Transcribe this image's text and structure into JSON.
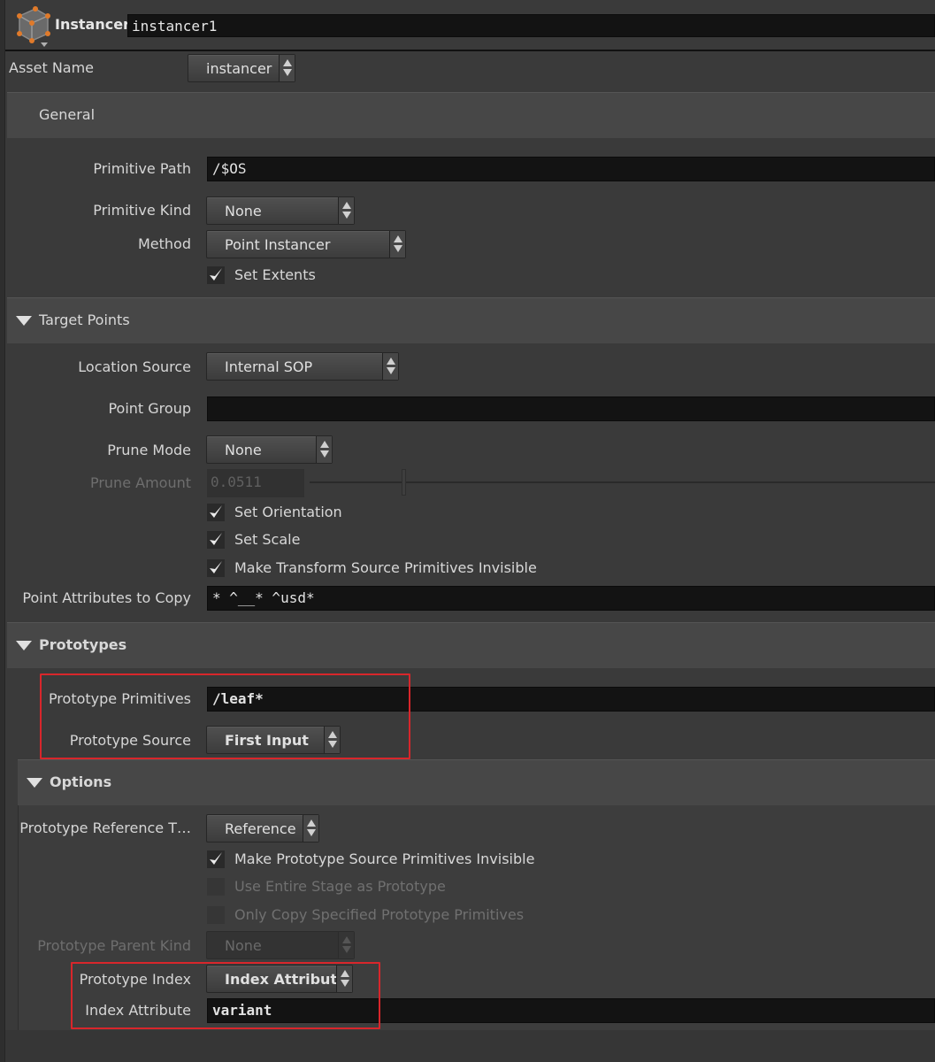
{
  "header": {
    "node_type": "Instancer",
    "node_name": "instancer1",
    "icon": "instancer-cube-icon"
  },
  "asset": {
    "label": "Asset Name",
    "value": "instancer"
  },
  "general": {
    "title": "General",
    "primitive_path_label": "Primitive Path",
    "primitive_path_value": "/$OS",
    "primitive_kind_label": "Primitive Kind",
    "primitive_kind_value": "None",
    "method_label": "Method",
    "method_value": "Point Instancer",
    "set_extents_label": "Set Extents",
    "set_extents_checked": true
  },
  "target_points": {
    "title": "Target Points",
    "location_source_label": "Location Source",
    "location_source_value": "Internal SOP",
    "point_group_label": "Point Group",
    "point_group_value": "",
    "prune_mode_label": "Prune Mode",
    "prune_mode_value": "None",
    "prune_amount_label": "Prune Amount",
    "prune_amount_value": "0.0511",
    "prune_amount_fraction": 0.0511,
    "set_orientation_label": "Set Orientation",
    "set_scale_label": "Set Scale",
    "make_invisible_label": "Make Transform Source Primitives Invisible",
    "point_attribs_label": "Point Attributes to Copy",
    "point_attribs_value": "* ^__* ^usd*"
  },
  "prototypes": {
    "title": "Prototypes",
    "prototype_primitives_label": "Prototype Primitives",
    "prototype_primitives_value": "/leaf*",
    "prototype_source_label": "Prototype Source",
    "prototype_source_value": "First Input"
  },
  "options": {
    "title": "Options",
    "reference_type_label": "Prototype Reference T…",
    "reference_type_value": "Reference",
    "make_proto_invisible_label": "Make Prototype Source Primitives Invisible",
    "use_entire_stage_label": "Use Entire Stage as Prototype",
    "only_copy_label": "Only Copy Specified Prototype Primitives",
    "parent_kind_label": "Prototype Parent Kind",
    "parent_kind_value": "None",
    "prototype_index_label": "Prototype Index",
    "prototype_index_value": "Index Attribute",
    "index_attribute_label": "Index Attribute",
    "index_attribute_value": "variant"
  },
  "colors": {
    "highlight_box": "#d8262b",
    "background": "#3a3a3a"
  }
}
